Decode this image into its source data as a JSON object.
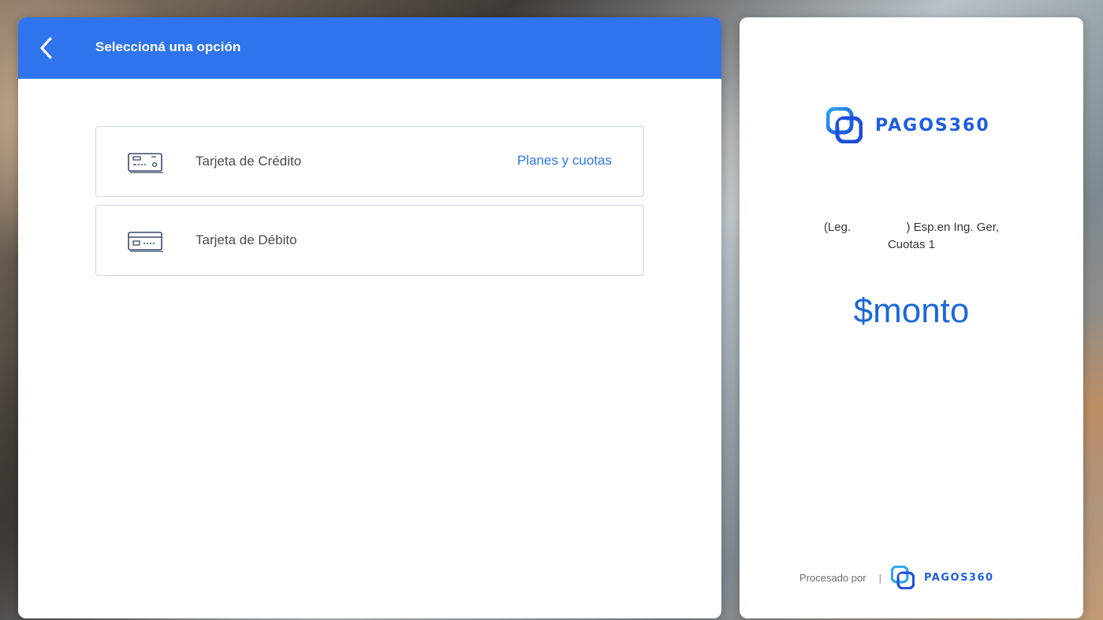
{
  "header": {
    "title": "Seleccioná una opción",
    "back_icon": "chevron-left-icon"
  },
  "options": [
    {
      "label": "Tarjeta de Crédito",
      "link": "Planes y cuotas",
      "icon": "credit-card-icon"
    },
    {
      "label": "Tarjeta de Débito",
      "icon": "debit-card-icon"
    }
  ],
  "summary": {
    "brand": "PAGOS360",
    "desc_prefix": "(Leg.",
    "desc_suffix": ") Esp.en Ing. Ger,",
    "desc_line2": "Cuotas 1",
    "amount": "$monto"
  },
  "footer": {
    "processed_by": "Procesado por",
    "separator": "|",
    "brand": "PAGOS360"
  },
  "colors": {
    "primary": "#2f74ec",
    "brand": "#1d5de0",
    "amount": "#1d68d9"
  }
}
